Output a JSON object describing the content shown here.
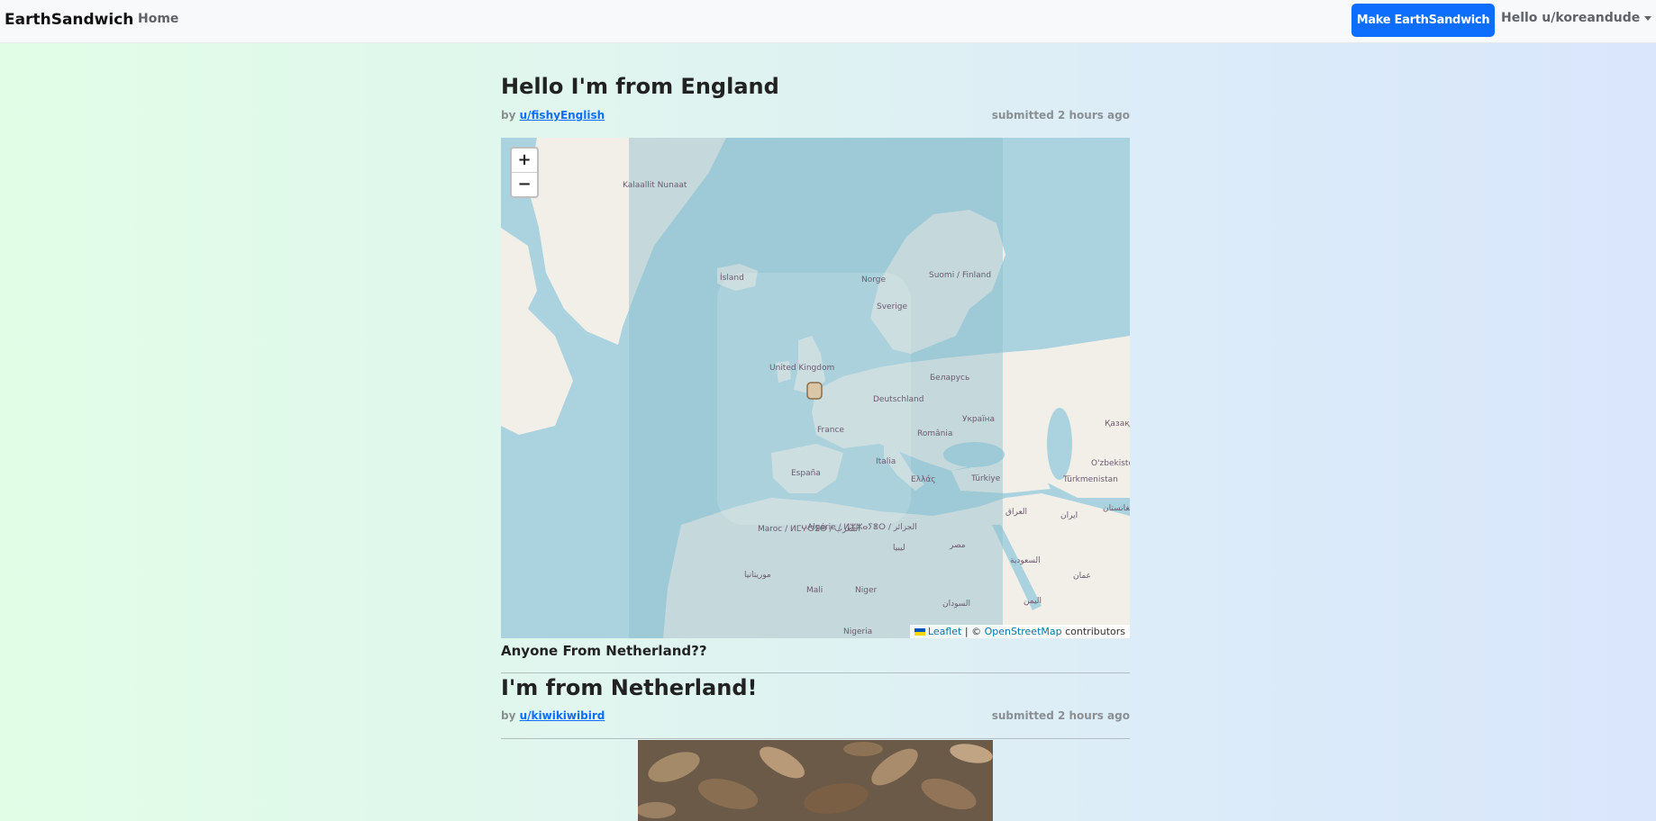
{
  "nav": {
    "brand": "EarthSandwich",
    "home": "Home",
    "make_button": "Make EarthSandwich",
    "user_menu": "Hello u/koreandude"
  },
  "posts": [
    {
      "title": "Hello I'm from England",
      "by_prefix": "by",
      "author": "u/fishyEnglish",
      "submitted": "submitted 2 hours ago",
      "caption": "Anyone From Netherland??",
      "map": {
        "zoom_in": "+",
        "zoom_out": "−",
        "attribution_leaflet": "Leaflet",
        "attribution_sep": " | © ",
        "attribution_osm": "OpenStreetMap",
        "attribution_suffix": " contributors",
        "labels": {
          "greenland": "Kalaallit Nunaat",
          "iceland": "Ísland",
          "norway": "Norge",
          "finland": "Suomi / Finland",
          "sweden": "Sverige",
          "uk": "United Kingdom",
          "belarus": "Беларусь",
          "germany": "Deutschland",
          "ukraine": "Україна",
          "kazakhstan": "Қазақ",
          "france": "France",
          "romania": "România",
          "uzbekistan": "O'zbekiston",
          "italy": "Italia",
          "spain": "España",
          "greece": "Ελλάς",
          "turkey": "Türkiye",
          "turkmenistan": "Türkmenistan",
          "iraq": "العراق",
          "iran": "ایران",
          "afghanistan": "افغانستان",
          "morocco": "Maroc / ⵍⵎⵖⵔⵉⴱ / المغرب",
          "algeria": "Algérie / ⵍⵣⵣⴰⵢⴻⵔ / الجزائر",
          "libya": "ليبيا",
          "egypt": "مصر",
          "saudi": "السعودية",
          "oman": "عمان",
          "mauritania": "موريتانيا",
          "mali": "Mali",
          "niger": "Niger",
          "sudan": "السودان",
          "yemen": "اليمن",
          "nigeria": "Nigeria"
        }
      }
    },
    {
      "title": "I'm from Netherland!",
      "by_prefix": "by",
      "author": "u/kiwikiwibird",
      "submitted": "submitted 2 hours ago"
    }
  ],
  "colors": {
    "primary": "#0d6efd",
    "sea": "#aad3df",
    "land": "#f2efe9"
  }
}
